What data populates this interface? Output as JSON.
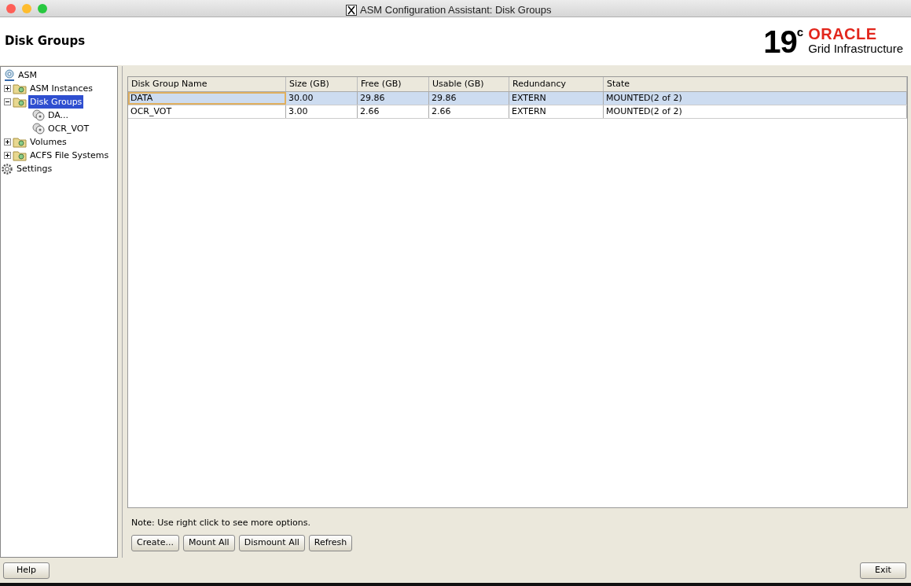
{
  "window": {
    "title": "ASM Configuration Assistant: Disk Groups"
  },
  "header": {
    "title": "Disk Groups",
    "logo": {
      "version": "19",
      "superscript": "c",
      "brand": "ORACLE",
      "product": "Grid Infrastructure"
    }
  },
  "tree": [
    {
      "label": "ASM",
      "kind": "asm",
      "selected": false
    },
    {
      "label": "ASM Instances",
      "kind": "folder",
      "expanded": false,
      "selected": false
    },
    {
      "label": "Disk Groups",
      "kind": "folder",
      "expanded": true,
      "selected": true,
      "children": [
        {
          "label": "DA...",
          "kind": "disk",
          "selected": false
        },
        {
          "label": "OCR_VOT",
          "kind": "disk",
          "selected": false
        }
      ]
    },
    {
      "label": "Volumes",
      "kind": "folder",
      "expanded": false,
      "selected": false
    },
    {
      "label": "ACFS File Systems",
      "kind": "folder",
      "expanded": false,
      "selected": false
    },
    {
      "label": "Settings",
      "kind": "settings",
      "selected": false
    }
  ],
  "table": {
    "columns": [
      "Disk Group Name",
      "Size (GB)",
      "Free (GB)",
      "Usable (GB)",
      "Redundancy",
      "State"
    ],
    "rows": [
      {
        "cells": [
          "DATA",
          "30.00",
          "29.86",
          "29.86",
          "EXTERN",
          "MOUNTED(2 of 2)"
        ],
        "selected": true
      },
      {
        "cells": [
          "OCR_VOT",
          "3.00",
          "2.66",
          "2.66",
          "EXTERN",
          "MOUNTED(2 of 2)"
        ],
        "selected": false
      }
    ]
  },
  "note": "Note: Use right click to see more options.",
  "actions": [
    "Create...",
    "Mount All",
    "Dismount All",
    "Refresh"
  ],
  "footer": {
    "help": "Help",
    "exit": "Exit"
  }
}
